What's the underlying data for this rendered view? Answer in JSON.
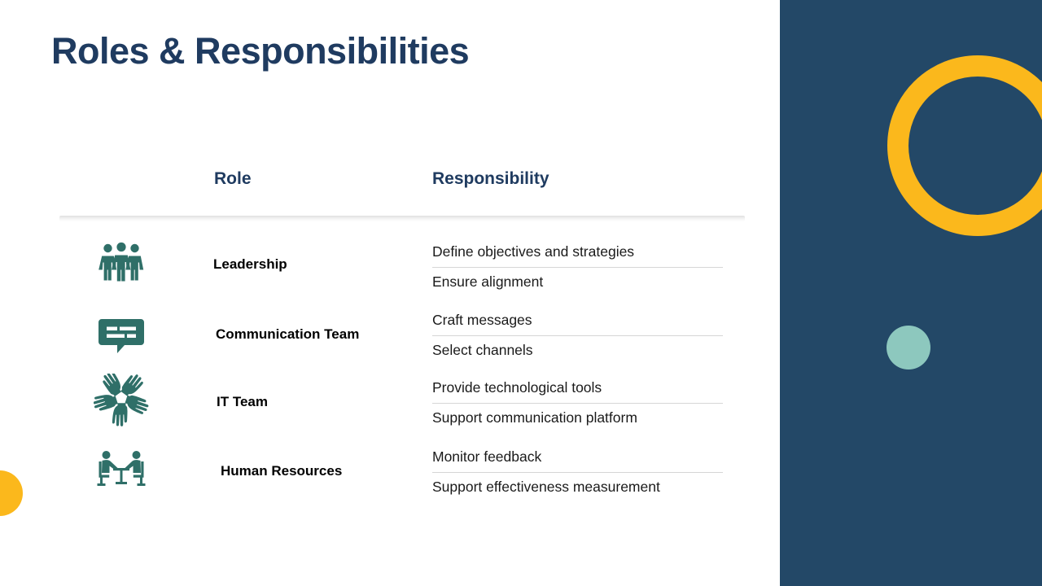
{
  "slide": {
    "title": "Roles & Responsibilities",
    "background_color": "#FFFFFF"
  },
  "theme": {
    "navy": "#234867",
    "title_navy": "#1F3B60",
    "yellow": "#FBB81C",
    "teal_icon": "#2F6F68",
    "mint": "#8DC8BE",
    "rule_gray": "#D6D6D6"
  },
  "table": {
    "headers": {
      "role": "Role",
      "responsibility": "Responsibility"
    },
    "rows": [
      {
        "icon": "three-people-icon",
        "role": "Leadership",
        "responsibilities": [
          "Define objectives and strategies",
          "Ensure alignment"
        ]
      },
      {
        "icon": "speech-bubble-icon",
        "role": "Communication Team",
        "responsibilities": [
          "Craft messages",
          "Select channels"
        ]
      },
      {
        "icon": "teamwork-hands-icon",
        "role": "IT Team",
        "responsibilities": [
          "Provide technological tools",
          "Support communication platform"
        ]
      },
      {
        "icon": "meeting-table-icon",
        "role": "Human Resources",
        "responsibilities": [
          "Monitor feedback",
          "Support effectiveness measurement"
        ]
      }
    ]
  },
  "decorations": {
    "right_panel": "navy-side-panel",
    "ring": "yellow-ring-shape",
    "dot": "mint-circle-shape",
    "corner_circle": "yellow-corner-circle-shape"
  }
}
